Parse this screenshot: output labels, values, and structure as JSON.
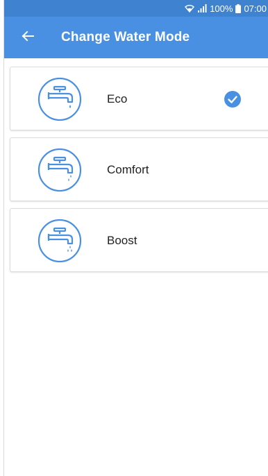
{
  "status_bar": {
    "battery": "100%",
    "time": "07:00"
  },
  "app_bar": {
    "title": "Change Water Mode",
    "back_icon": "arrow-left-icon"
  },
  "modes": [
    {
      "label": "Eco",
      "icon": "faucet-eco-icon",
      "selected": true
    },
    {
      "label": "Comfort",
      "icon": "faucet-comfort-icon",
      "selected": false
    },
    {
      "label": "Boost",
      "icon": "faucet-boost-icon",
      "selected": false
    }
  ],
  "colors": {
    "primary": "#4a90e2",
    "status_bar": "#3f83d0",
    "icon_stroke": "#4a90e2",
    "check": "#4a90e2"
  }
}
